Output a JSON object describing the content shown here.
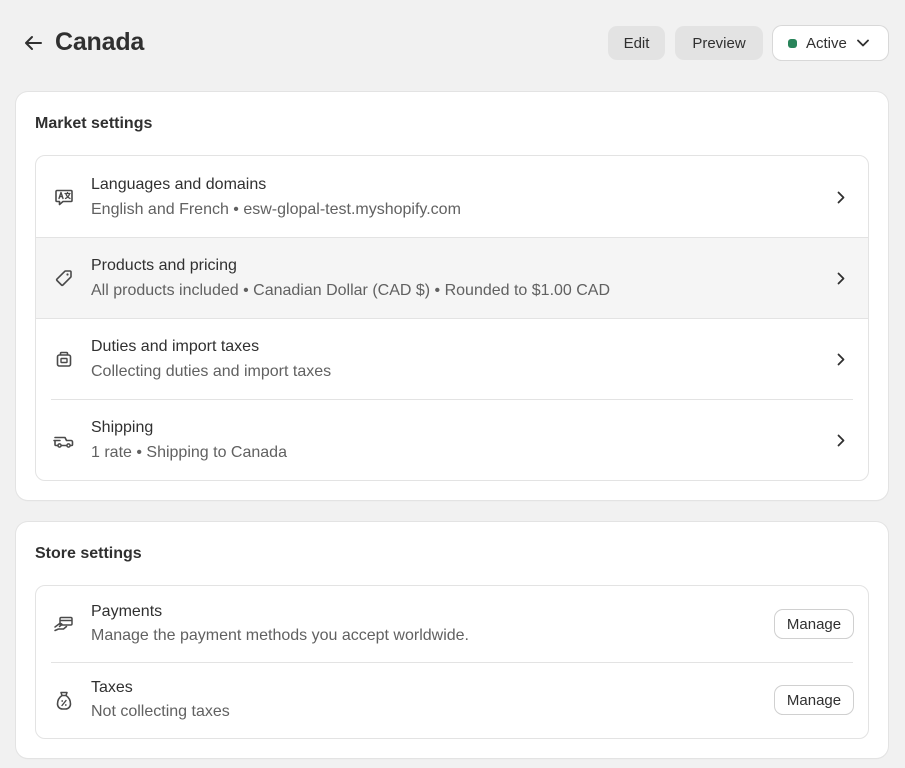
{
  "header": {
    "title": "Canada",
    "edit_label": "Edit",
    "preview_label": "Preview",
    "status_label": "Active",
    "status_color": "#29845a"
  },
  "market_settings": {
    "title": "Market settings",
    "rows": [
      {
        "icon": "translate-icon",
        "title": "Languages and domains",
        "subtitle": "English and French • esw-glopal-test.myshopify.com"
      },
      {
        "icon": "price-tag-icon",
        "title": "Products and pricing",
        "subtitle": "All products included • Canadian Dollar (CAD $) • Rounded to $1.00 CAD"
      },
      {
        "icon": "package-icon",
        "title": "Duties and import taxes",
        "subtitle": "Collecting duties and import taxes"
      },
      {
        "icon": "delivery-truck-icon",
        "title": "Shipping",
        "subtitle": "1 rate • Shipping to Canada"
      }
    ]
  },
  "store_settings": {
    "title": "Store settings",
    "rows": [
      {
        "icon": "payment-hand-icon",
        "title": "Payments",
        "subtitle": "Manage the payment methods you accept worldwide.",
        "action": "Manage"
      },
      {
        "icon": "tax-bag-icon",
        "title": "Taxes",
        "subtitle": "Not collecting taxes",
        "action": "Manage"
      }
    ]
  }
}
